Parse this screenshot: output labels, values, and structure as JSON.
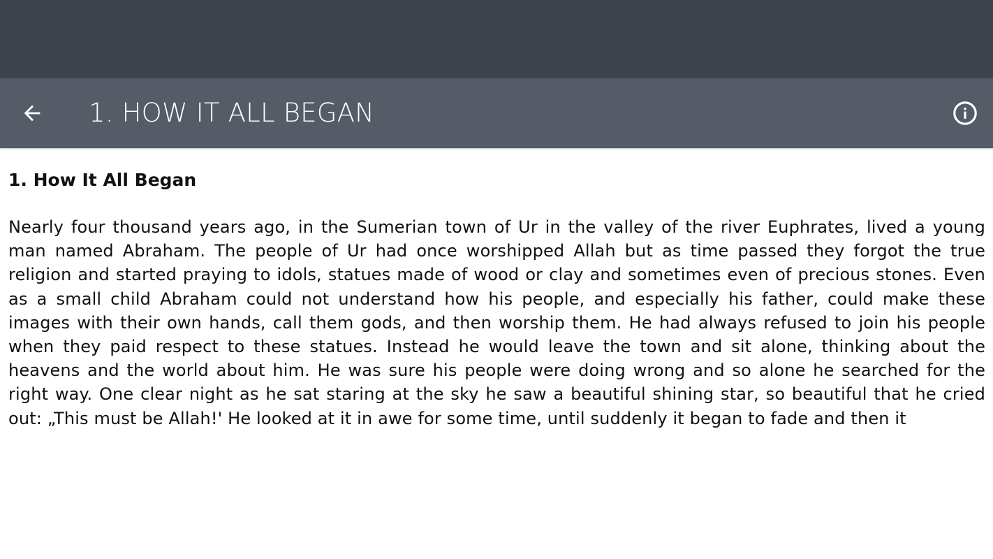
{
  "app_bar": {
    "title": "1. HOW IT ALL BEGAN",
    "background_color": "#555c67",
    "status_bar_color": "#3f434b",
    "back_icon": "arrow-back-icon",
    "info_icon": "info-circle-icon"
  },
  "content": {
    "heading": "1. How It All Began",
    "paragraph": "Nearly four thousand years ago, in the Sumerian town of Ur in the valley of the river Euphrates, lived a young man named Abraham. The people of Ur had once worshipped Allah but as time passed they forgot the true religion and started praying to idols, statues made of wood or clay and sometimes even of precious stones. Even as a small child Abraham could not understand how his people, and especially his father, could make these images with their own hands, call them gods, and then worship them. He had always refused to join his people when they paid respect to these statues. Instead he would leave the town and sit alone, thinking about the heavens and the world about him. He was sure his people were doing wrong and so alone he searched for the right way. One clear night as he sat staring at the sky he saw a beautiful shining star, so beautiful that he cried out: „This must be Allah!' He looked at it in awe for some time, until suddenly it began to fade and then it"
  }
}
